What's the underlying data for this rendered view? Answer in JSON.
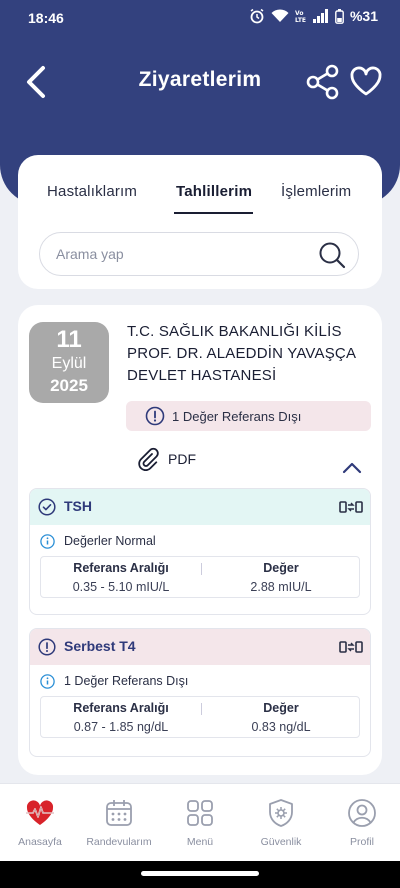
{
  "status_bar": {
    "time": "18:46",
    "battery": "%31"
  },
  "header": {
    "title": "Ziyaretlerim"
  },
  "tabs": [
    {
      "label": "Hastalıklarım",
      "active": false
    },
    {
      "label": "Tahlillerim",
      "active": true
    },
    {
      "label": "İşlemlerim",
      "active": false
    }
  ],
  "search": {
    "placeholder": "Arama yap"
  },
  "visit": {
    "date": {
      "day": "11",
      "month": "Eylül",
      "year": "2025"
    },
    "hospital_name": "T.C. SAĞLIK BAKANLIĞI KİLİS PROF. DR. ALAEDDİN YAVAŞÇA DEVLET HASTANESİ",
    "reference_badge": "1 Değer Referans Dışı",
    "pdf_label": "PDF"
  },
  "tests": [
    {
      "name": "TSH",
      "status": "normal",
      "info": "Değerler Normal",
      "ref_header": "Referans Aralığı",
      "value_header": "Değer",
      "ref_range": "0.35 - 5.10 mIU/L",
      "value": "2.88 mIU/L"
    },
    {
      "name": "Serbest T4",
      "status": "abnormal",
      "info": "1 Değer Referans Dışı",
      "ref_header": "Referans Aralığı",
      "value_header": "Değer",
      "ref_range": "0.87 - 1.85 ng/dL",
      "value": "0.83 ng/dL"
    }
  ],
  "bottom_nav": [
    {
      "label": "Anasayfa",
      "icon": "heart-pulse-icon"
    },
    {
      "label": "Randevularım",
      "icon": "calendar-icon"
    },
    {
      "label": "Menü",
      "icon": "grid-icon"
    },
    {
      "label": "Güvenlik",
      "icon": "shield-gear-icon"
    },
    {
      "label": "Profil",
      "icon": "user-icon"
    }
  ],
  "colors": {
    "header": "#33417e",
    "normal_bg": "#e3f6f4",
    "abnormal_bg": "#f4e6ea",
    "brand_red": "#d8232a"
  }
}
